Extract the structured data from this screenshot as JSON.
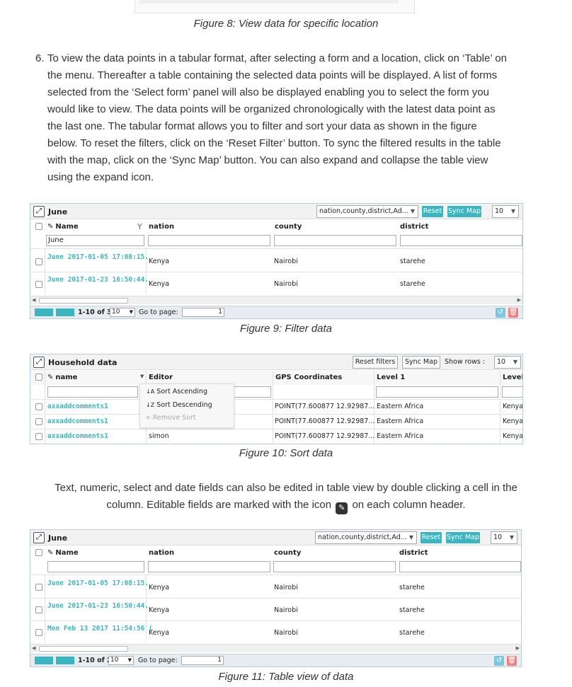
{
  "fig8": {
    "caption": "Figure 8: View data for specific location"
  },
  "step6": {
    "number": "6.",
    "lines": [
      "To view the data points in a tabular format, after selecting a form and a location, click on ‘Table’ on",
      "the menu. Thereafter a table containing the selected data points will be displayed. A list of forms",
      "selected from the ‘Select form’ panel will also be displayed enabling you to select the form you",
      "would like to view. The data points will be organized chronologically with the latest data point as",
      "the last one. The tabular format allows you to filter and sort your data as shown in the figure",
      "below. To reset the filters, click on the ‘Reset Filter’ button. To sync the filtered results in the table",
      "with the map, click on the ‘Sync Map’ button. You can also expand and collapse the table view",
      "using the expand icon."
    ]
  },
  "fig9": {
    "title": "June",
    "columns_select": "nation,county,district,Ad...",
    "reset_label": "Reset",
    "sync_label": "Sync Map",
    "rows_value": "10",
    "headers": {
      "name": "Name",
      "nation": "nation",
      "county": "county",
      "district": "district"
    },
    "filter_value": "June",
    "rows": [
      {
        "name": "June 2017-01-05 17:08:15.",
        "nation": "Kenya",
        "county": "Nairobi",
        "district": "starehe"
      },
      {
        "name": "June 2017-01-23 16:50:44.",
        "nation": "Kenya",
        "county": "Nairobi",
        "district": "starehe"
      }
    ],
    "pager_range": "1-10 of 3",
    "pager_size": "10",
    "goto_label": "Go to page:",
    "goto_value": "1",
    "caption": "Figure 9: Filter data"
  },
  "fig10": {
    "title": "Household data",
    "reset_label": "Reset filters",
    "sync_label": "Sync Map",
    "show_rows_label": "Show rows :",
    "rows_value": "10",
    "headers": {
      "name": "name",
      "editor": "Editor",
      "gps": "GPS Coordinates",
      "level1": "Level 1",
      "level": "Level"
    },
    "menu": {
      "asc": "Sort Ascending",
      "desc": "Sort Descending",
      "remove": "Remove Sort"
    },
    "rows": [
      {
        "name": "axxaddcomments1",
        "editor": "",
        "gps": "POINT(77.600877 12.92987...",
        "level1": "Eastern Africa",
        "level": "Kenya"
      },
      {
        "name": "axxaddcomments1",
        "editor": "",
        "gps": "POINT(77.600877 12.92987...",
        "level1": "Eastern Africa",
        "level": "Kenya"
      },
      {
        "name": "axxaddcomments1",
        "editor": "simon",
        "gps": "POINT(77.600877 12.92987...",
        "level1": "Eastern Africa",
        "level": "Kenya"
      }
    ],
    "caption": "Figure 10: Sort data"
  },
  "edit_note": {
    "line1": "Text, numeric, select and date fields can also be edited in table view by double clicking a cell in the",
    "line2_before": "column. Editable fields are marked with the icon",
    "line2_after": "on each column header."
  },
  "fig11": {
    "title": "June",
    "columns_select": "nation,county,district,Ad...",
    "reset_label": "Reset",
    "sync_label": "Sync Map",
    "rows_value": "10",
    "headers": {
      "name": "Name",
      "nation": "nation",
      "county": "county",
      "district": "district"
    },
    "rows": [
      {
        "name": "June 2017-01-05 17:08:15.",
        "nation": "Kenya",
        "county": "Nairobi",
        "district": "starehe"
      },
      {
        "name": "June 2017-01-23 16:50:44.",
        "nation": "Kenya",
        "county": "Nairobi",
        "district": "starehe"
      },
      {
        "name": "Mon Feb 13 2017 11:54:56 (",
        "nation": "Kenya",
        "county": "Nairobi",
        "district": "starehe"
      }
    ],
    "pager_range": "1-10 of 2",
    "pager_size": "10",
    "goto_label": "Go to page:",
    "goto_value": "1",
    "caption": "Figure 11: Table view of data"
  },
  "colors": {
    "accent": "#3bb5bf",
    "danger": "#f08080",
    "border": "#b8cdd6"
  }
}
